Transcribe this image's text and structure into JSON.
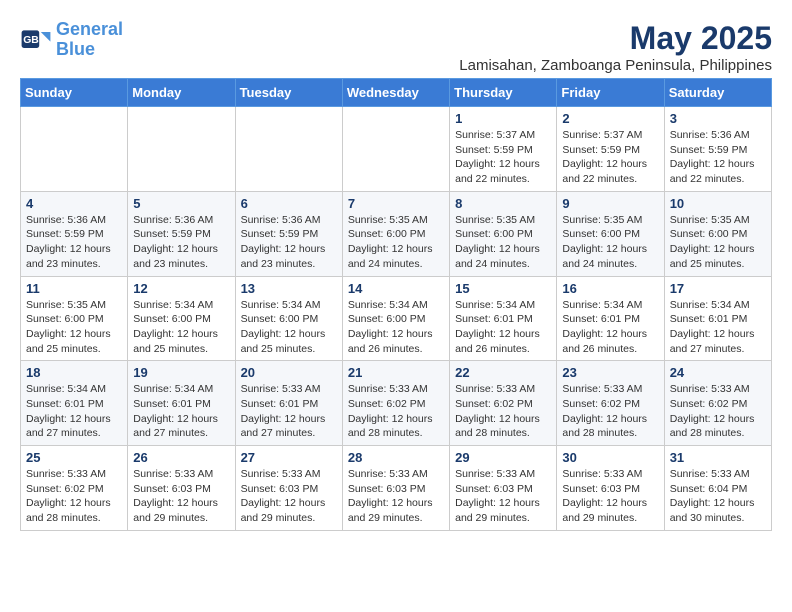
{
  "header": {
    "logo_line1": "General",
    "logo_line2": "Blue",
    "month_year": "May 2025",
    "location": "Lamisahan, Zamboanga Peninsula, Philippines"
  },
  "weekdays": [
    "Sunday",
    "Monday",
    "Tuesday",
    "Wednesday",
    "Thursday",
    "Friday",
    "Saturday"
  ],
  "weeks": [
    [
      {
        "day": "",
        "info": ""
      },
      {
        "day": "",
        "info": ""
      },
      {
        "day": "",
        "info": ""
      },
      {
        "day": "",
        "info": ""
      },
      {
        "day": "1",
        "info": "Sunrise: 5:37 AM\nSunset: 5:59 PM\nDaylight: 12 hours\nand 22 minutes."
      },
      {
        "day": "2",
        "info": "Sunrise: 5:37 AM\nSunset: 5:59 PM\nDaylight: 12 hours\nand 22 minutes."
      },
      {
        "day": "3",
        "info": "Sunrise: 5:36 AM\nSunset: 5:59 PM\nDaylight: 12 hours\nand 22 minutes."
      }
    ],
    [
      {
        "day": "4",
        "info": "Sunrise: 5:36 AM\nSunset: 5:59 PM\nDaylight: 12 hours\nand 23 minutes."
      },
      {
        "day": "5",
        "info": "Sunrise: 5:36 AM\nSunset: 5:59 PM\nDaylight: 12 hours\nand 23 minutes."
      },
      {
        "day": "6",
        "info": "Sunrise: 5:36 AM\nSunset: 5:59 PM\nDaylight: 12 hours\nand 23 minutes."
      },
      {
        "day": "7",
        "info": "Sunrise: 5:35 AM\nSunset: 6:00 PM\nDaylight: 12 hours\nand 24 minutes."
      },
      {
        "day": "8",
        "info": "Sunrise: 5:35 AM\nSunset: 6:00 PM\nDaylight: 12 hours\nand 24 minutes."
      },
      {
        "day": "9",
        "info": "Sunrise: 5:35 AM\nSunset: 6:00 PM\nDaylight: 12 hours\nand 24 minutes."
      },
      {
        "day": "10",
        "info": "Sunrise: 5:35 AM\nSunset: 6:00 PM\nDaylight: 12 hours\nand 25 minutes."
      }
    ],
    [
      {
        "day": "11",
        "info": "Sunrise: 5:35 AM\nSunset: 6:00 PM\nDaylight: 12 hours\nand 25 minutes."
      },
      {
        "day": "12",
        "info": "Sunrise: 5:34 AM\nSunset: 6:00 PM\nDaylight: 12 hours\nand 25 minutes."
      },
      {
        "day": "13",
        "info": "Sunrise: 5:34 AM\nSunset: 6:00 PM\nDaylight: 12 hours\nand 25 minutes."
      },
      {
        "day": "14",
        "info": "Sunrise: 5:34 AM\nSunset: 6:00 PM\nDaylight: 12 hours\nand 26 minutes."
      },
      {
        "day": "15",
        "info": "Sunrise: 5:34 AM\nSunset: 6:01 PM\nDaylight: 12 hours\nand 26 minutes."
      },
      {
        "day": "16",
        "info": "Sunrise: 5:34 AM\nSunset: 6:01 PM\nDaylight: 12 hours\nand 26 minutes."
      },
      {
        "day": "17",
        "info": "Sunrise: 5:34 AM\nSunset: 6:01 PM\nDaylight: 12 hours\nand 27 minutes."
      }
    ],
    [
      {
        "day": "18",
        "info": "Sunrise: 5:34 AM\nSunset: 6:01 PM\nDaylight: 12 hours\nand 27 minutes."
      },
      {
        "day": "19",
        "info": "Sunrise: 5:34 AM\nSunset: 6:01 PM\nDaylight: 12 hours\nand 27 minutes."
      },
      {
        "day": "20",
        "info": "Sunrise: 5:33 AM\nSunset: 6:01 PM\nDaylight: 12 hours\nand 27 minutes."
      },
      {
        "day": "21",
        "info": "Sunrise: 5:33 AM\nSunset: 6:02 PM\nDaylight: 12 hours\nand 28 minutes."
      },
      {
        "day": "22",
        "info": "Sunrise: 5:33 AM\nSunset: 6:02 PM\nDaylight: 12 hours\nand 28 minutes."
      },
      {
        "day": "23",
        "info": "Sunrise: 5:33 AM\nSunset: 6:02 PM\nDaylight: 12 hours\nand 28 minutes."
      },
      {
        "day": "24",
        "info": "Sunrise: 5:33 AM\nSunset: 6:02 PM\nDaylight: 12 hours\nand 28 minutes."
      }
    ],
    [
      {
        "day": "25",
        "info": "Sunrise: 5:33 AM\nSunset: 6:02 PM\nDaylight: 12 hours\nand 28 minutes."
      },
      {
        "day": "26",
        "info": "Sunrise: 5:33 AM\nSunset: 6:03 PM\nDaylight: 12 hours\nand 29 minutes."
      },
      {
        "day": "27",
        "info": "Sunrise: 5:33 AM\nSunset: 6:03 PM\nDaylight: 12 hours\nand 29 minutes."
      },
      {
        "day": "28",
        "info": "Sunrise: 5:33 AM\nSunset: 6:03 PM\nDaylight: 12 hours\nand 29 minutes."
      },
      {
        "day": "29",
        "info": "Sunrise: 5:33 AM\nSunset: 6:03 PM\nDaylight: 12 hours\nand 29 minutes."
      },
      {
        "day": "30",
        "info": "Sunrise: 5:33 AM\nSunset: 6:03 PM\nDaylight: 12 hours\nand 29 minutes."
      },
      {
        "day": "31",
        "info": "Sunrise: 5:33 AM\nSunset: 6:04 PM\nDaylight: 12 hours\nand 30 minutes."
      }
    ]
  ]
}
